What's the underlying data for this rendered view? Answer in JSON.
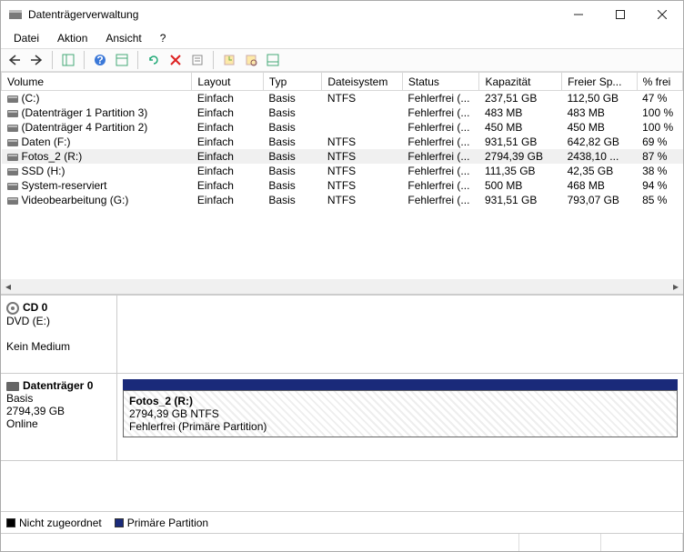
{
  "window": {
    "title": "Datenträgerverwaltung"
  },
  "menu": {
    "items": [
      "Datei",
      "Aktion",
      "Ansicht",
      "?"
    ]
  },
  "toolbar": {
    "back": "back-arrow",
    "fwd": "forward-arrow",
    "view": "view-tree",
    "help": "help",
    "refresh": "refresh",
    "export": "export",
    "delete": "delete",
    "props": "properties",
    "list": "list",
    "detail": "detail"
  },
  "table": {
    "columns": [
      "Volume",
      "Layout",
      "Typ",
      "Dateisystem",
      "Status",
      "Kapazität",
      "Freier Sp...",
      "% frei"
    ],
    "rows": [
      {
        "vol": "(C:)",
        "layout": "Einfach",
        "typ": "Basis",
        "fs": "NTFS",
        "status": "Fehlerfrei (...",
        "cap": "237,51 GB",
        "free": "112,50 GB",
        "pct": "47 %"
      },
      {
        "vol": "(Datenträger 1 Partition 3)",
        "layout": "Einfach",
        "typ": "Basis",
        "fs": "",
        "status": "Fehlerfrei (...",
        "cap": "483 MB",
        "free": "483 MB",
        "pct": "100 %"
      },
      {
        "vol": "(Datenträger 4 Partition 2)",
        "layout": "Einfach",
        "typ": "Basis",
        "fs": "",
        "status": "Fehlerfrei (...",
        "cap": "450 MB",
        "free": "450 MB",
        "pct": "100 %"
      },
      {
        "vol": "Daten (F:)",
        "layout": "Einfach",
        "typ": "Basis",
        "fs": "NTFS",
        "status": "Fehlerfrei (...",
        "cap": "931,51 GB",
        "free": "642,82 GB",
        "pct": "69 %"
      },
      {
        "vol": "Fotos_2 (R:)",
        "layout": "Einfach",
        "typ": "Basis",
        "fs": "NTFS",
        "status": "Fehlerfrei (...",
        "cap": "2794,39 GB",
        "free": "2438,10 ...",
        "pct": "87 %",
        "selected": true
      },
      {
        "vol": "SSD (H:)",
        "layout": "Einfach",
        "typ": "Basis",
        "fs": "NTFS",
        "status": "Fehlerfrei (...",
        "cap": "111,35 GB",
        "free": "42,35 GB",
        "pct": "38 %"
      },
      {
        "vol": "System-reserviert",
        "layout": "Einfach",
        "typ": "Basis",
        "fs": "NTFS",
        "status": "Fehlerfrei (...",
        "cap": "500 MB",
        "free": "468 MB",
        "pct": "94 %"
      },
      {
        "vol": "Videobearbeitung (G:)",
        "layout": "Einfach",
        "typ": "Basis",
        "fs": "NTFS",
        "status": "Fehlerfrei (...",
        "cap": "931,51 GB",
        "free": "793,07 GB",
        "pct": "85 %"
      }
    ]
  },
  "disks": {
    "cd": {
      "name": "CD 0",
      "sub": "DVD (E:)",
      "status": "Kein Medium"
    },
    "disk0": {
      "name": "Datenträger 0",
      "type": "Basis",
      "size": "2794,39 GB",
      "status": "Online",
      "part": {
        "name": "Fotos_2  (R:)",
        "info": "2794,39 GB NTFS",
        "state": "Fehlerfrei (Primäre Partition)"
      }
    }
  },
  "legend": {
    "unalloc": "Nicht zugeordnet",
    "primary": "Primäre Partition"
  }
}
